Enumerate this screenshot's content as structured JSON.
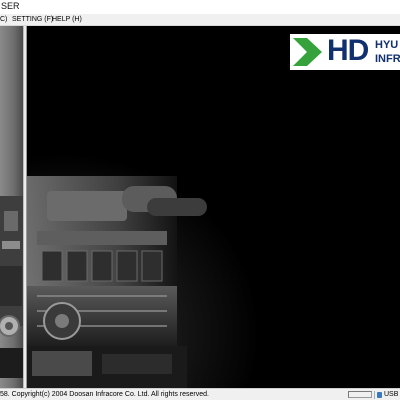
{
  "window": {
    "title": "SER"
  },
  "menu": {
    "item_c": "C)",
    "setting": "SETTING (F)",
    "help": "HELP (H)"
  },
  "logo": {
    "text": "HD",
    "line1": "HYU",
    "line2": "INFRA"
  },
  "statusbar": {
    "copyright": "58. Copyright(c) 2004 Doosan Infracore Co. Ltd. All rights reserved.",
    "usb_label": "USB"
  },
  "colors": {
    "logo_green": "#35a23b",
    "logo_navy": "#10306e"
  }
}
